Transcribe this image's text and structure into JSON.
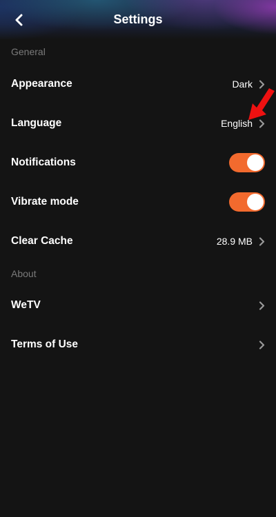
{
  "header": {
    "title": "Settings",
    "back_icon": "chevron-left-icon"
  },
  "sections": {
    "general": "General",
    "about": "About"
  },
  "rows": {
    "appearance": {
      "label": "Appearance",
      "value": "Dark"
    },
    "language": {
      "label": "Language",
      "value": "English"
    },
    "notifications": {
      "label": "Notifications",
      "enabled": true
    },
    "vibrate": {
      "label": "Vibrate mode",
      "enabled": true
    },
    "clear_cache": {
      "label": "Clear Cache",
      "value": "28.9 MB"
    },
    "wetv": {
      "label": "WeTV"
    },
    "terms": {
      "label": "Terms of Use"
    }
  },
  "colors": {
    "background": "#141414",
    "toggle_on": "#f26a2e",
    "annotation_arrow": "#ee1111",
    "section_label": "#7a7a7a"
  },
  "annotation": {
    "icon": "red-arrow-icon"
  }
}
